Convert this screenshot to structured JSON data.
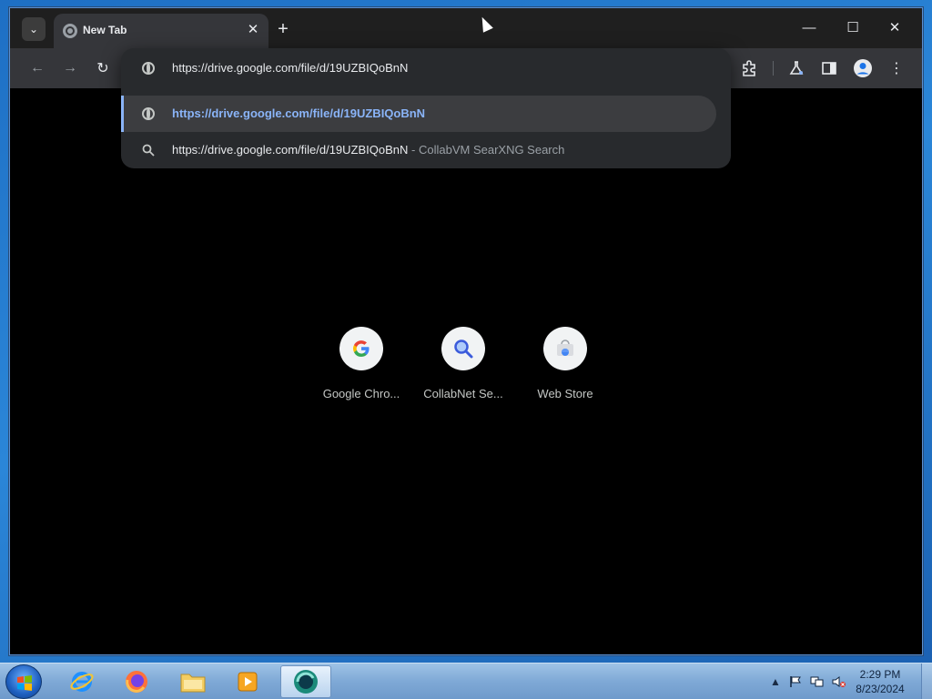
{
  "browser": {
    "tab": {
      "title": "New Tab",
      "close": "✕"
    },
    "new_tab": "+",
    "window_controls": {
      "minimize": "—",
      "maximize": "☐",
      "close": "✕"
    }
  },
  "omnibox": {
    "input_value": "https://drive.google.com/file/d/19UZBIQoBnN",
    "suggestions": [
      {
        "text": "https://drive.google.com/file/d/19UZBIQoBnN",
        "description": ""
      },
      {
        "text": "https://drive.google.com/file/d/19UZBIQoBnN",
        "description": "- CollabVM SearXNG Search"
      }
    ]
  },
  "shortcuts": [
    {
      "label": "Google Chro...",
      "icon": "google-g-icon"
    },
    {
      "label": "CollabNet Se...",
      "icon": "magnifier-icon"
    },
    {
      "label": "Web Store",
      "icon": "web-store-icon"
    }
  ],
  "taskbar": {
    "clock_time": "2:29 PM",
    "clock_date": "8/23/2024",
    "tray_arrow": "▲"
  },
  "colors": {
    "accent": "#8ab4f8",
    "page_background": "#000000",
    "toolbar": "#35363a"
  }
}
